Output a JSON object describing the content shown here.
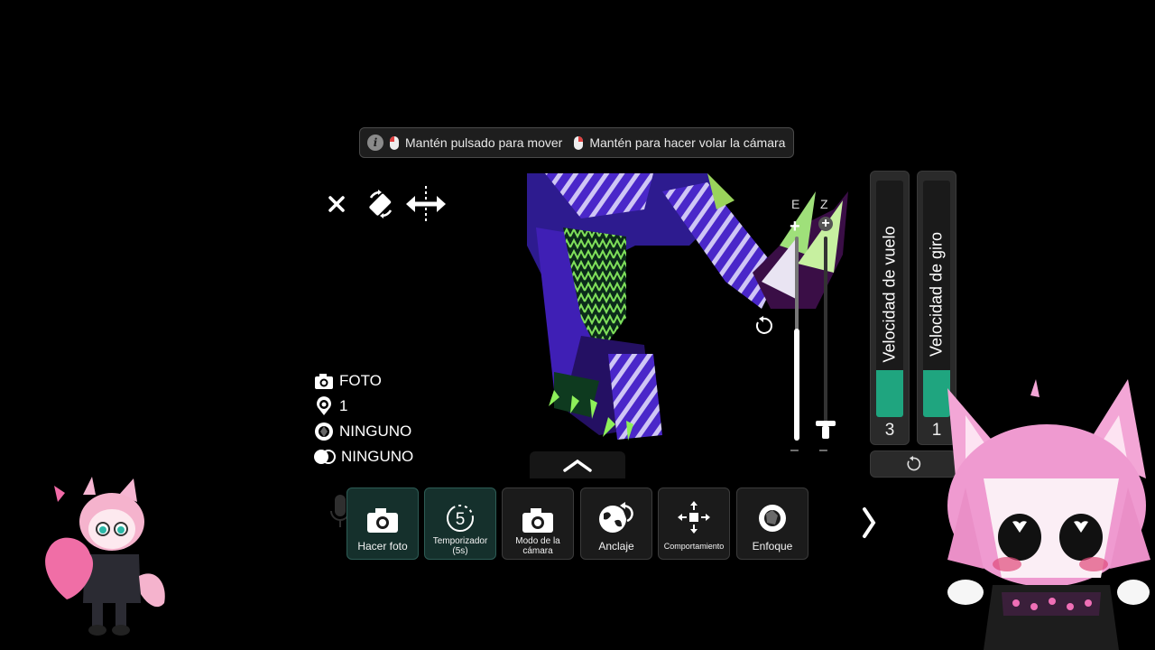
{
  "hint": {
    "move": "Mantén pulsado para mover",
    "fly": "Mantén para hacer volar la cámara"
  },
  "tools": {
    "close_icon": "close-icon",
    "rotate_icon": "rotate-orientation-icon",
    "move_icon": "move-arrows-icon"
  },
  "zoom": {
    "label_e": "E",
    "label_z": "Z",
    "plus": "+",
    "minus": "–",
    "level_e": 0.55
  },
  "speed": {
    "flight_label": "Velocidad de vuelo",
    "flight_value": "3",
    "flight_level": 0.2,
    "turn_label": "Velocidad de giro",
    "turn_value": "1",
    "turn_level": 0.2
  },
  "status": {
    "mode": "FOTO",
    "count": "1",
    "filter": "NINGUNO",
    "overlay": "NINGUNO"
  },
  "toolbar": {
    "photo": "Hacer foto",
    "timer": "Temporizador (5s)",
    "timer_num": "5",
    "camera_mode": "Modo de la cámara",
    "anchor": "Anclaje",
    "behavior": "Comportamiento",
    "focus": "Enfoque"
  },
  "colors": {
    "accent": "#1fa57f",
    "active_button": "#15302c"
  }
}
